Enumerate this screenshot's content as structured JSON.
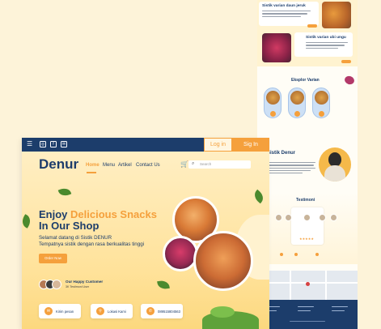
{
  "brand": "Denur",
  "topbar": {
    "login_label": "Log in",
    "signin_label": "Sig In"
  },
  "nav": [
    {
      "label": "Home",
      "active": true
    },
    {
      "label": "Menu",
      "active": false
    },
    {
      "label": "Artikel",
      "active": false
    },
    {
      "label": "Contact Us",
      "active": false
    }
  ],
  "search": {
    "placeholder": "Search"
  },
  "hero": {
    "title_prefix": "Enjoy ",
    "title_accent": "Delicious Snacks",
    "title_line2": "In Our Shop",
    "subtitle_line1": "Selamat datang di Sistik DENUR",
    "subtitle_line2": "Tempatnya sistik dengan rasa berkualitas tinggi",
    "cta_label": "Order Now"
  },
  "customers": {
    "title": "Our Happy Customer",
    "subtitle": "3K Testimoni User"
  },
  "info_cards": [
    {
      "icon": "chat-icon",
      "label": "Kirim pesan"
    },
    {
      "icon": "location-icon",
      "label": "Lokasi Kami"
    },
    {
      "icon": "phone-icon",
      "label": "089515804563"
    }
  ],
  "side_page": {
    "variant1_title": "Sistik varian daun jeruk",
    "variant2_title": "Sistik varian ubi ungu",
    "explore_title": "Eksplor Varian",
    "about_title": "Sistik Denur",
    "testimoni_title": "Testimoni"
  },
  "colors": {
    "navy": "#1c3d6b",
    "accent": "#f5a03c",
    "background": "#fdf3d9"
  }
}
